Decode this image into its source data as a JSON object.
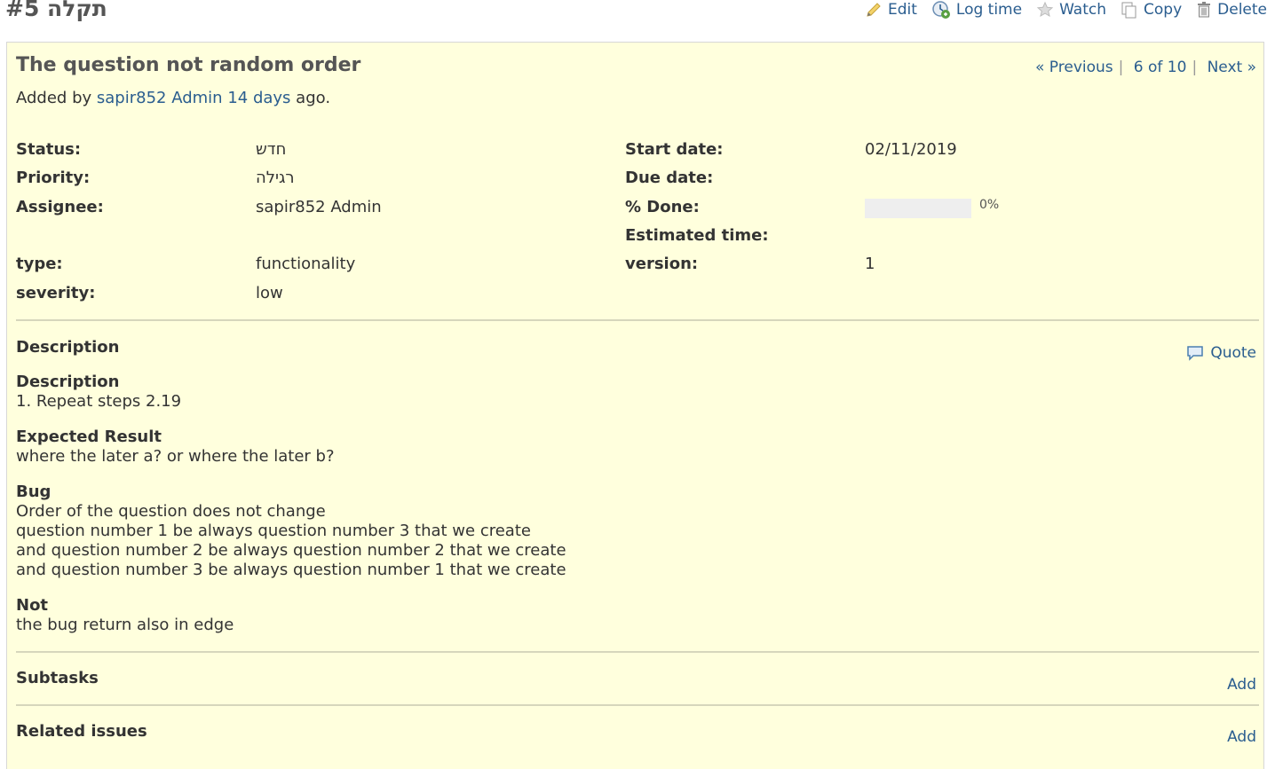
{
  "header": {
    "issue_id": "תקלה #5",
    "actions": [
      {
        "label": "Edit",
        "icon": "pencil-icon"
      },
      {
        "label": "Log time",
        "icon": "clock-icon"
      },
      {
        "label": "Watch",
        "icon": "star-icon"
      },
      {
        "label": "Copy",
        "icon": "copy-icon"
      },
      {
        "label": "Delete",
        "icon": "trash-icon"
      }
    ]
  },
  "issue": {
    "subject": "The question not random order",
    "nav": {
      "previous": "« Previous",
      "position": "6 of 10",
      "next": "Next »"
    },
    "author": {
      "prefix": "Added by",
      "user": "sapir852 Admin",
      "age": "14 days",
      "suffix": "ago."
    },
    "attributes_left": [
      {
        "label": "Status:",
        "value": "חדש"
      },
      {
        "label": "Priority:",
        "value": "רגילה"
      },
      {
        "label": "Assignee:",
        "value": "sapir852 Admin"
      },
      {
        "label": "type:",
        "value": "functionality"
      },
      {
        "label": "severity:",
        "value": "low"
      }
    ],
    "attributes_right": [
      {
        "label": "Start date:",
        "value": "02/11/2019"
      },
      {
        "label": "Due date:",
        "value": ""
      },
      {
        "label": "% Done:",
        "value": "0%"
      },
      {
        "label": "Estimated time:",
        "value": ""
      },
      {
        "label": "version:",
        "value": "1"
      }
    ],
    "done_percent": 0,
    "description_title": "Description",
    "quote_label": "Quote",
    "description": {
      "sections": [
        {
          "heading": "Description",
          "lines": [
            "1. Repeat steps 2.19"
          ]
        },
        {
          "heading": "Expected Result",
          "lines": [
            "where the later a? or where the later b?"
          ]
        },
        {
          "heading": "Bug",
          "lines": [
            "Order of the question does not change",
            "question number 1 be always question number 3 that we create",
            "and question number 2 be always question number 2 that we create",
            "and question number 3 be always question number 1 that we create"
          ]
        },
        {
          "heading": "Not",
          "lines": [
            "the bug return also in edge"
          ]
        }
      ]
    },
    "subtasks_title": "Subtasks",
    "subtasks_add": "Add",
    "related_title": "Related issues",
    "related_add": "Add"
  },
  "colors": {
    "link": "#2a5d8f",
    "panel_bg": "#ffffdd",
    "text": "#333333"
  }
}
